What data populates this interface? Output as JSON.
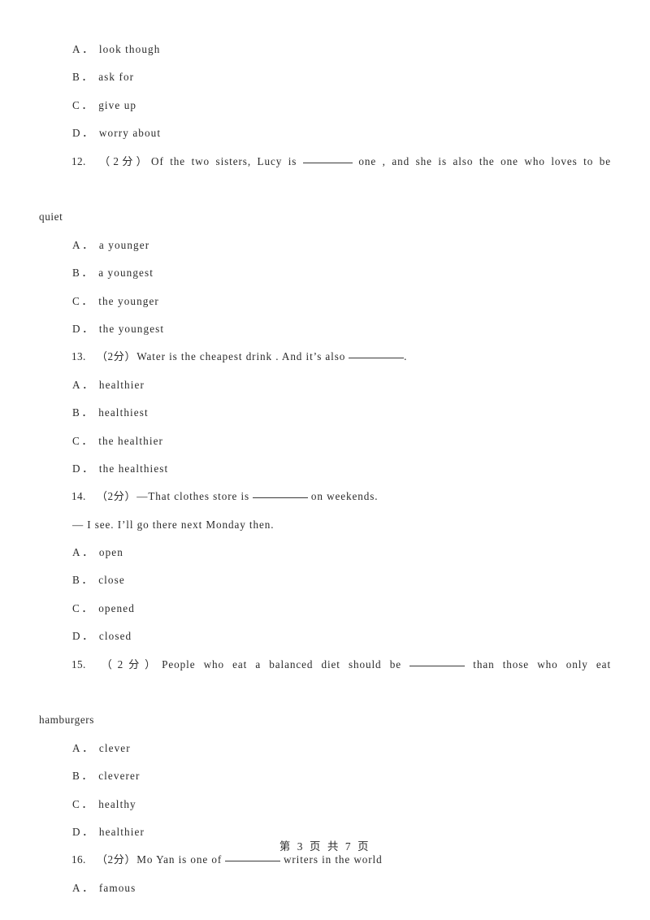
{
  "document": {
    "page_label": "第 3 页 共 7 页",
    "page_number": "3",
    "total_pages": "7",
    "marks_label": "（2分）",
    "option_separator": "．"
  },
  "blocks": [
    {
      "kind": "option_orphan",
      "letter": "A",
      "text": "look though"
    },
    {
      "kind": "option_orphan",
      "letter": "B",
      "text": "ask for"
    },
    {
      "kind": "option_orphan",
      "letter": "C",
      "text": "give up"
    },
    {
      "kind": "option_orphan",
      "letter": "D",
      "text": "worry about"
    }
  ],
  "questions": [
    {
      "number": "12.",
      "marks": "（2分）",
      "stem_line1": "Of the two sisters, Lucy is ______ one , and she is also the one who loves to be",
      "stem_part_a": "Of the two sisters, Lucy is",
      "stem_part_b": "one , and she is also the one who loves to be",
      "stem_line2": "quiet",
      "wrapped": true,
      "options": [
        {
          "letter": "A",
          "text": "a younger"
        },
        {
          "letter": "B",
          "text": "a youngest"
        },
        {
          "letter": "C",
          "text": "the younger"
        },
        {
          "letter": "D",
          "text": "the youngest"
        }
      ]
    },
    {
      "number": "13.",
      "marks": "（2分）",
      "stem_part_a": "Water is the cheapest drink . And it’s also",
      "stem_part_b": ".",
      "wrapped": false,
      "options": [
        {
          "letter": "A",
          "text": "healthier"
        },
        {
          "letter": "B",
          "text": "healthiest"
        },
        {
          "letter": "C",
          "text": "the healthier"
        },
        {
          "letter": "D",
          "text": "the healthiest"
        }
      ]
    },
    {
      "number": "14.",
      "marks": "（2分）",
      "stem_part_a": "—That clothes store is",
      "stem_part_b": "on weekends.",
      "wrapped": false,
      "dialog_line": "— I see. I’ll go there next Monday then.",
      "options": [
        {
          "letter": "A",
          "text": "open"
        },
        {
          "letter": "B",
          "text": "close"
        },
        {
          "letter": "C",
          "text": "opened"
        },
        {
          "letter": "D",
          "text": "closed"
        }
      ]
    },
    {
      "number": "15.",
      "marks": "（2分）",
      "stem_part_a": "People who eat a balanced diet should be",
      "stem_part_b": "than those who only eat",
      "stem_line2": "hamburgers",
      "wrapped": true,
      "options": [
        {
          "letter": "A",
          "text": "clever"
        },
        {
          "letter": "B",
          "text": "cleverer"
        },
        {
          "letter": "C",
          "text": "healthy"
        },
        {
          "letter": "D",
          "text": "healthier"
        }
      ]
    },
    {
      "number": "16.",
      "marks": "（2分）",
      "stem_part_a": "Mo Yan is one of",
      "stem_part_b": "writers in the world",
      "wrapped": false,
      "options": [
        {
          "letter": "A",
          "text": "famous"
        }
      ]
    }
  ]
}
